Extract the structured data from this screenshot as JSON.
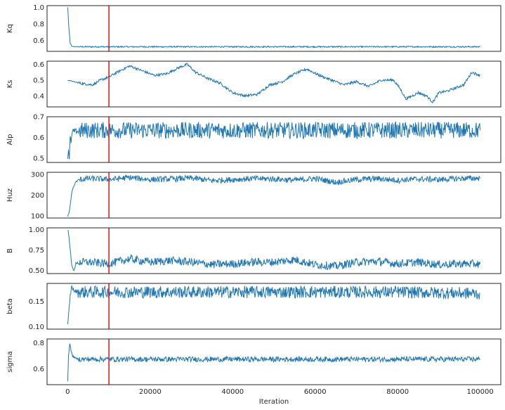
{
  "chart_data": {
    "type": "line",
    "layout": "stacked-trace-plots",
    "xlabel": "Iteration",
    "xlim": [
      -5000,
      105000
    ],
    "xticks": [
      0,
      20000,
      40000,
      60000,
      80000,
      100000
    ],
    "xtick_labels": [
      "0",
      "20000",
      "40000",
      "60000",
      "80000",
      "100000"
    ],
    "grid": false,
    "legend": "none",
    "line_color": "#1f77b4",
    "marker_color": "#d62728",
    "burn_in": 10000,
    "panels": [
      {
        "ylabel": "Kq",
        "ylim": [
          0.47,
          1.02
        ],
        "yticks": [
          0.6,
          0.8,
          1.0
        ],
        "ytick_labels": [
          "0.6",
          "0.8",
          "1.0"
        ],
        "series": [
          {
            "x": [
              0,
              300,
              600,
              1000,
              2000,
              5000,
              10000,
              20000,
              40000,
              60000,
              80000,
              100000
            ],
            "y": [
              1.0,
              0.75,
              0.57,
              0.53,
              0.525,
              0.525,
              0.525,
              0.525,
              0.525,
              0.525,
              0.525,
              0.525
            ]
          }
        ]
      },
      {
        "ylabel": "Ks",
        "ylim": [
          0.33,
          0.62
        ],
        "yticks": [
          0.4,
          0.5,
          0.6
        ],
        "ytick_labels": [
          "0.4",
          "0.5",
          "0.6"
        ],
        "series": [
          {
            "x": [
              0,
              3000,
              6000,
              8000,
              10000,
              12000,
              15000,
              18000,
              21000,
              24000,
              27000,
              29000,
              31000,
              34000,
              37000,
              40000,
              43000,
              46000,
              49000,
              52000,
              55000,
              58000,
              61000,
              64000,
              67000,
              70000,
              73000,
              76000,
              79000,
              80500,
              82000,
              85000,
              87000,
              88500,
              90000,
              92000,
              94000,
              96000,
              98000,
              100000
            ],
            "y": [
              0.5,
              0.48,
              0.47,
              0.5,
              0.52,
              0.55,
              0.59,
              0.56,
              0.53,
              0.54,
              0.58,
              0.6,
              0.55,
              0.51,
              0.48,
              0.42,
              0.4,
              0.41,
              0.47,
              0.49,
              0.54,
              0.57,
              0.53,
              0.5,
              0.47,
              0.49,
              0.46,
              0.5,
              0.5,
              0.45,
              0.38,
              0.42,
              0.4,
              0.36,
              0.42,
              0.43,
              0.45,
              0.47,
              0.55,
              0.53
            ]
          }
        ]
      },
      {
        "ylabel": "Alp",
        "ylim": [
          0.48,
          0.7
        ],
        "yticks": [
          0.5,
          0.6,
          0.7
        ],
        "ytick_labels": [
          "0.5",
          "0.6",
          "0.7"
        ],
        "series": [
          {
            "x": [
              0,
              200,
              400,
              600,
              800,
              1200,
              2000,
              5000,
              10000,
              20000,
              40000,
              60000,
              80000,
              100000
            ],
            "y": [
              0.5,
              0.55,
              0.49,
              0.6,
              0.58,
              0.63,
              0.63,
              0.635,
              0.635,
              0.635,
              0.635,
              0.635,
              0.635,
              0.635
            ]
          }
        ]
      },
      {
        "ylabel": "Huz",
        "ylim": [
          90,
          310
        ],
        "yticks": [
          100,
          200,
          300
        ],
        "ytick_labels": [
          "100",
          "200",
          "300"
        ],
        "series": [
          {
            "x": [
              0,
              300,
              600,
              900,
              1200,
              2000,
              3000,
              5000,
              8000,
              10000,
              15000,
              20000,
              25000,
              30000,
              35000,
              40000,
              45000,
              50000,
              55000,
              60000,
              65000,
              70000,
              75000,
              80000,
              85000,
              90000,
              95000,
              100000
            ],
            "y": [
              100,
              110,
              150,
              200,
              230,
              265,
              275,
              280,
              278,
              275,
              285,
              275,
              278,
              282,
              270,
              275,
              280,
              278,
              272,
              280,
              262,
              275,
              280,
              272,
              278,
              275,
              280,
              282
            ]
          }
        ]
      },
      {
        "ylabel": "B",
        "ylim": [
          0.46,
          1.02
        ],
        "yticks": [
          0.5,
          0.75,
          1.0
        ],
        "ytick_labels": [
          "0.50",
          "0.75",
          "1.00"
        ],
        "series": [
          {
            "x": [
              0,
              300,
              600,
              1000,
              1500,
              2000,
              3000,
              5000,
              10000,
              15000,
              20000,
              25000,
              30000,
              35000,
              40000,
              45000,
              50000,
              55000,
              60000,
              65000,
              70000,
              75000,
              80000,
              85000,
              90000,
              95000,
              100000
            ],
            "y": [
              1.0,
              0.93,
              0.75,
              0.55,
              0.5,
              0.58,
              0.6,
              0.6,
              0.58,
              0.64,
              0.6,
              0.62,
              0.6,
              0.57,
              0.58,
              0.6,
              0.6,
              0.63,
              0.57,
              0.55,
              0.6,
              0.61,
              0.58,
              0.6,
              0.57,
              0.58,
              0.58
            ]
          }
        ]
      },
      {
        "ylabel": "beta",
        "ylim": [
          0.095,
          0.185
        ],
        "yticks": [
          0.1,
          0.15
        ],
        "ytick_labels": [
          "0.10",
          "0.15"
        ],
        "series": [
          {
            "x": [
              0,
              300,
              600,
              1000,
              1500,
              3000,
              10000,
              20000,
              40000,
              60000,
              80000,
              100000
            ],
            "y": [
              0.102,
              0.13,
              0.16,
              0.18,
              0.17,
              0.168,
              0.168,
              0.168,
              0.168,
              0.168,
              0.168,
              0.165
            ]
          }
        ]
      },
      {
        "ylabel": "sigma",
        "ylim": [
          0.48,
          0.83
        ],
        "yticks": [
          0.6,
          0.8
        ],
        "ytick_labels": [
          "0.6",
          "0.8"
        ],
        "series": [
          {
            "x": [
              0,
              200,
              500,
              800,
              1200,
              2000,
              3000,
              10000,
              20000,
              40000,
              60000,
              80000,
              100000
            ],
            "y": [
              0.5,
              0.7,
              0.8,
              0.74,
              0.7,
              0.68,
              0.675,
              0.675,
              0.675,
              0.675,
              0.675,
              0.675,
              0.675
            ]
          }
        ]
      }
    ]
  }
}
